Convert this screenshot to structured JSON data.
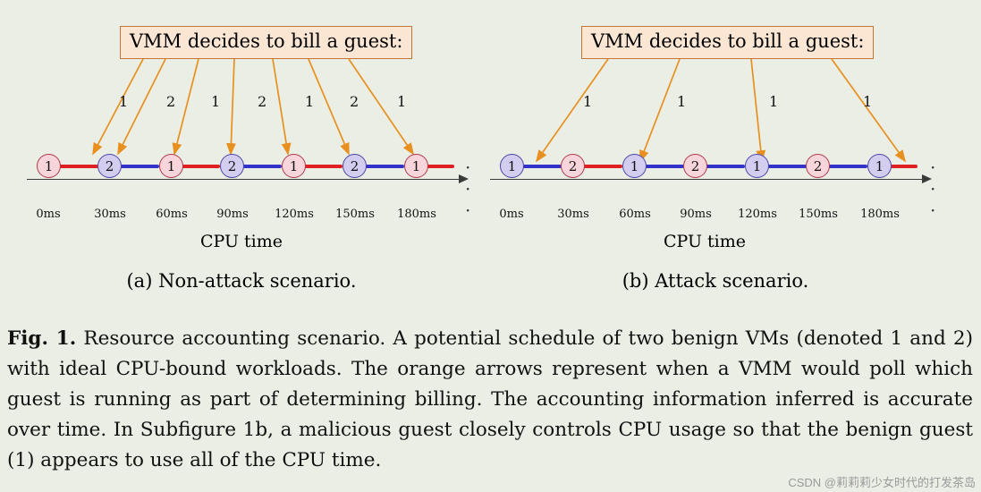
{
  "figure": {
    "callout_text": "VMM decides to bill a guest:",
    "cpu_time_label": "CPU time",
    "ellipsis": "· · ·",
    "subfigures": [
      {
        "id": "a",
        "caption": "(a) Non-attack scenario.",
        "arrow_counts": [
          "1",
          "2",
          "1",
          "2",
          "1",
          "2",
          "1"
        ],
        "ticks": [
          "0ms",
          "30ms",
          "60ms",
          "90ms",
          "120ms",
          "150ms",
          "180ms"
        ],
        "nodes": [
          "1",
          "2",
          "1",
          "2",
          "1",
          "2",
          "1"
        ],
        "segment_colors": [
          "#e02020",
          "#3333cc",
          "#e02020",
          "#3333cc",
          "#e02020",
          "#3333cc",
          "#e02020"
        ]
      },
      {
        "id": "b",
        "caption": "(b) Attack scenario.",
        "arrow_counts": [
          "1",
          "1",
          "1",
          "1"
        ],
        "ticks": [
          "0ms",
          "30ms",
          "60ms",
          "90ms",
          "120ms",
          "150ms",
          "180ms"
        ],
        "nodes": [
          "1",
          "2",
          "1",
          "2",
          "1",
          "2",
          "1"
        ],
        "segment_colors": [
          "#3333cc",
          "#e02020",
          "#3333cc",
          "#3333cc",
          "#3333cc",
          "#3333cc",
          "#e02020"
        ]
      }
    ]
  },
  "caption": {
    "label": "Fig. 1.",
    "text": " Resource accounting scenario. A potential schedule of two benign VMs (denoted 1 and 2) with ideal CPU-bound workloads. The orange arrows represent when a VMM would poll which guest is running as part of determining billing. The accounting information inferred is accurate over time. In Subfigure 1b, a malicious guest closely controls CPU usage so that the benign guest (1) appears to use all of the CPU time."
  },
  "watermark": "CSDN @莉莉莉少女时代的打发茶岛",
  "colors": {
    "guest1_fill": "#f7d5da",
    "guest1_stroke": "#b03a4a",
    "guest2_fill": "#d3cdf0",
    "guest2_stroke": "#4a46a8",
    "arrow": "#e8901f",
    "callout_bg": "#fbe6d4",
    "callout_border": "#c1763a",
    "segment_red": "#e02020",
    "segment_blue": "#3333cc",
    "background": "#eaeee4"
  }
}
